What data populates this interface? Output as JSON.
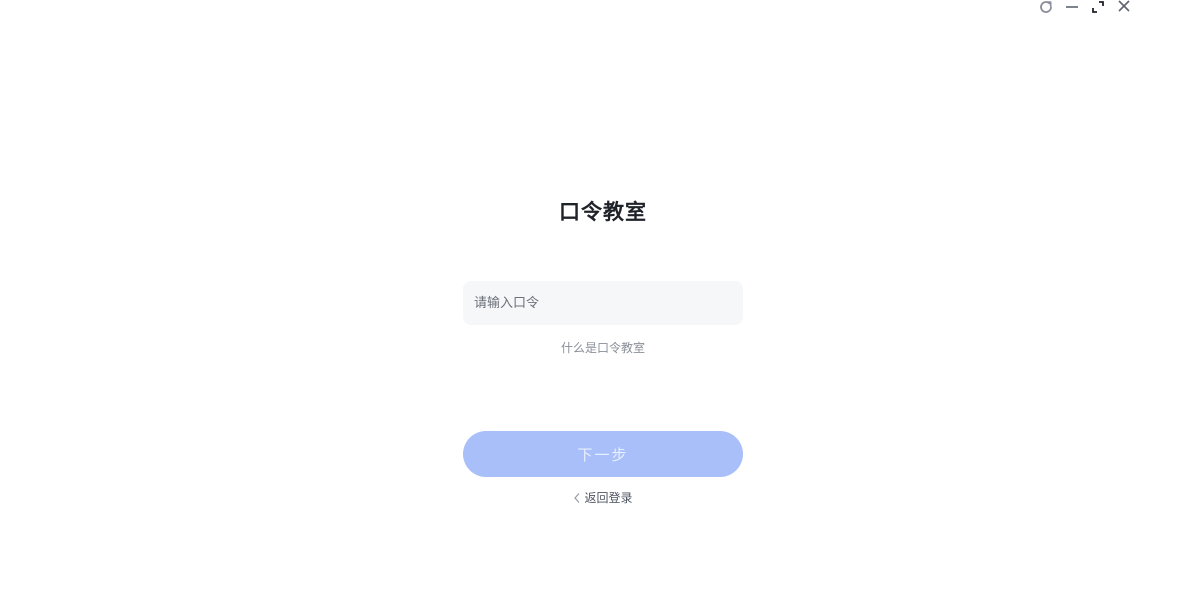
{
  "window_controls": {
    "refresh_icon": "refresh-icon",
    "minimize_icon": "minimize-icon",
    "restore_icon": "restore-icon",
    "close_icon": "close-icon"
  },
  "page": {
    "title": "口令教室",
    "input_placeholder": "请输入口令",
    "input_value": "",
    "help_link": "什么是口令教室",
    "next_button": "下一步",
    "back_link": "返回登录"
  },
  "colors": {
    "primary_disabled": "#a8bff9",
    "input_bg": "#f6f7f9",
    "title_text": "#1f2329"
  }
}
